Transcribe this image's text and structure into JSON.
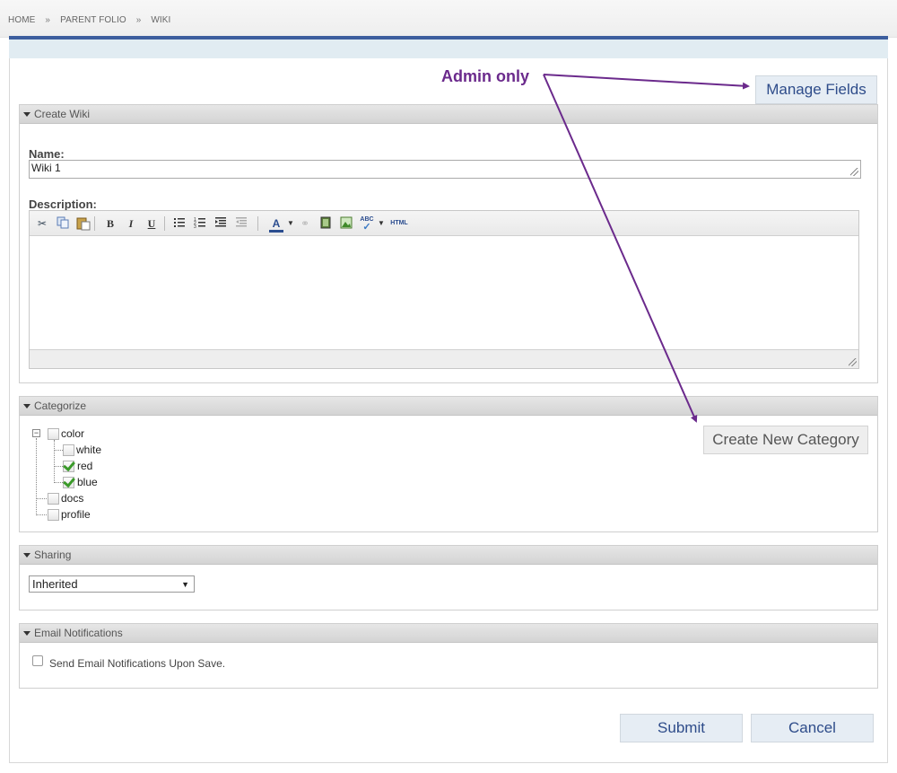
{
  "breadcrumb": {
    "items": [
      "HOME",
      "PARENT FOLIO",
      "WIKI"
    ],
    "separator": "»"
  },
  "annotation": {
    "text": "Admin only",
    "color": "#6b2a8c"
  },
  "manage_fields": {
    "label": "Manage Fields"
  },
  "create_wiki": {
    "header": "Create Wiki",
    "name_label": "Name:",
    "name_value": "Wiki 1",
    "description_label": "Description:",
    "toolbar_icons": [
      "cut-icon",
      "copy-icon",
      "paste-icon",
      "bold-icon",
      "italic-icon",
      "underline-icon",
      "bullet-list-icon",
      "numbered-list-icon",
      "indent-icon",
      "outdent-icon",
      "font-color-icon",
      "link-icon",
      "media-icon",
      "image-icon",
      "spellcheck-icon",
      "html-icon"
    ]
  },
  "categorize": {
    "header": "Categorize",
    "create_button": "Create New Category",
    "tree": [
      {
        "label": "color",
        "checked": false,
        "children": [
          {
            "label": "white",
            "checked": false
          },
          {
            "label": "red",
            "checked": true
          },
          {
            "label": "blue",
            "checked": true
          }
        ]
      },
      {
        "label": "docs",
        "checked": false
      },
      {
        "label": "profile",
        "checked": false
      }
    ]
  },
  "sharing": {
    "header": "Sharing",
    "selected": "Inherited"
  },
  "email": {
    "header": "Email Notifications",
    "label": "Send Email Notifications Upon Save.",
    "checked": false
  },
  "actions": {
    "submit": "Submit",
    "cancel": "Cancel"
  },
  "colors": {
    "accent": "#3d5e9e",
    "button_bg": "#e6edf4",
    "button_text": "#2e4c8a"
  }
}
